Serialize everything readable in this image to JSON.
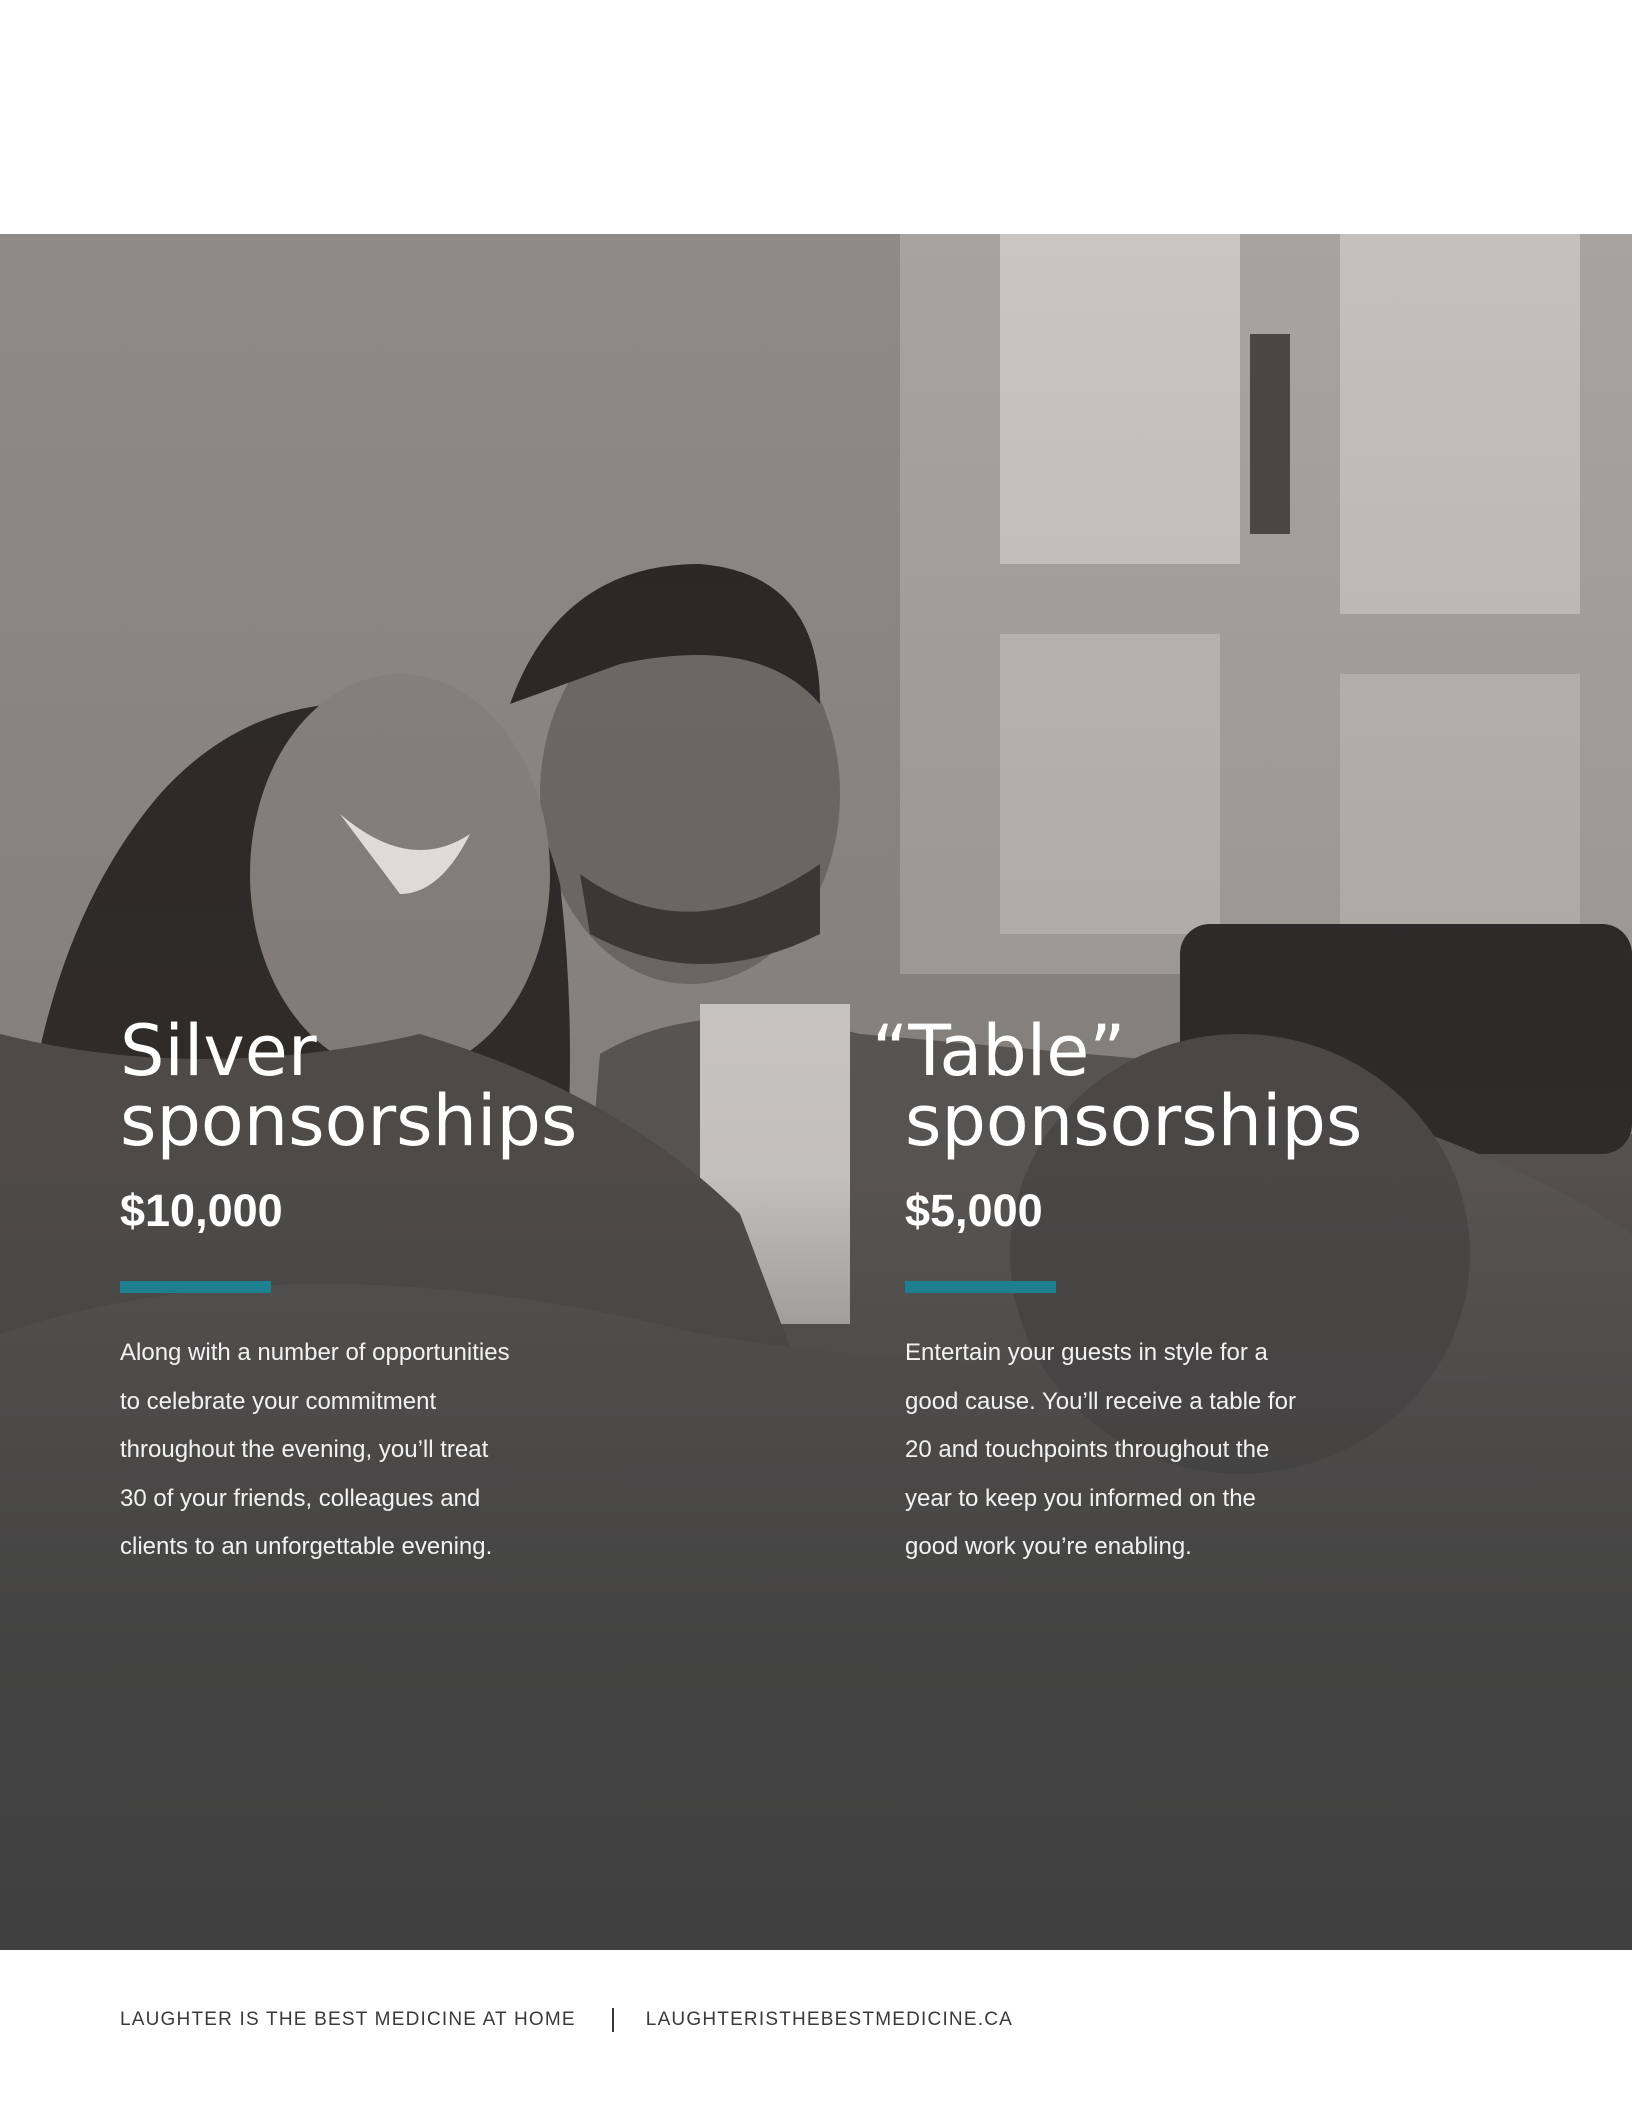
{
  "silver": {
    "title_line1": "Silver",
    "title_line2": "sponsorships",
    "price": "$10,000",
    "desc": [
      "Along with a number of opportunities",
      "to celebrate your commitment",
      "throughout the evening, you’ll treat",
      "30 of your friends, colleagues and",
      "clients to an unforgettable evening."
    ]
  },
  "table": {
    "title_line1": "“Table”",
    "title_line2": "sponsorships",
    "price": "$5,000",
    "desc": [
      "Entertain your guests in style for a",
      "good cause. You’ll receive a table for",
      "20 and touchpoints throughout the",
      "year to keep you informed on the",
      "good work you’re enabling."
    ]
  },
  "footer": {
    "tagline": "LAUGHTER IS THE BEST MEDICINE AT HOME",
    "url": "LAUGHTERISTHEBESTMEDICINE.CA"
  },
  "colors": {
    "accent": "#1e7f91",
    "overlay": "#404040",
    "text_on_photo": "#ffffff"
  }
}
